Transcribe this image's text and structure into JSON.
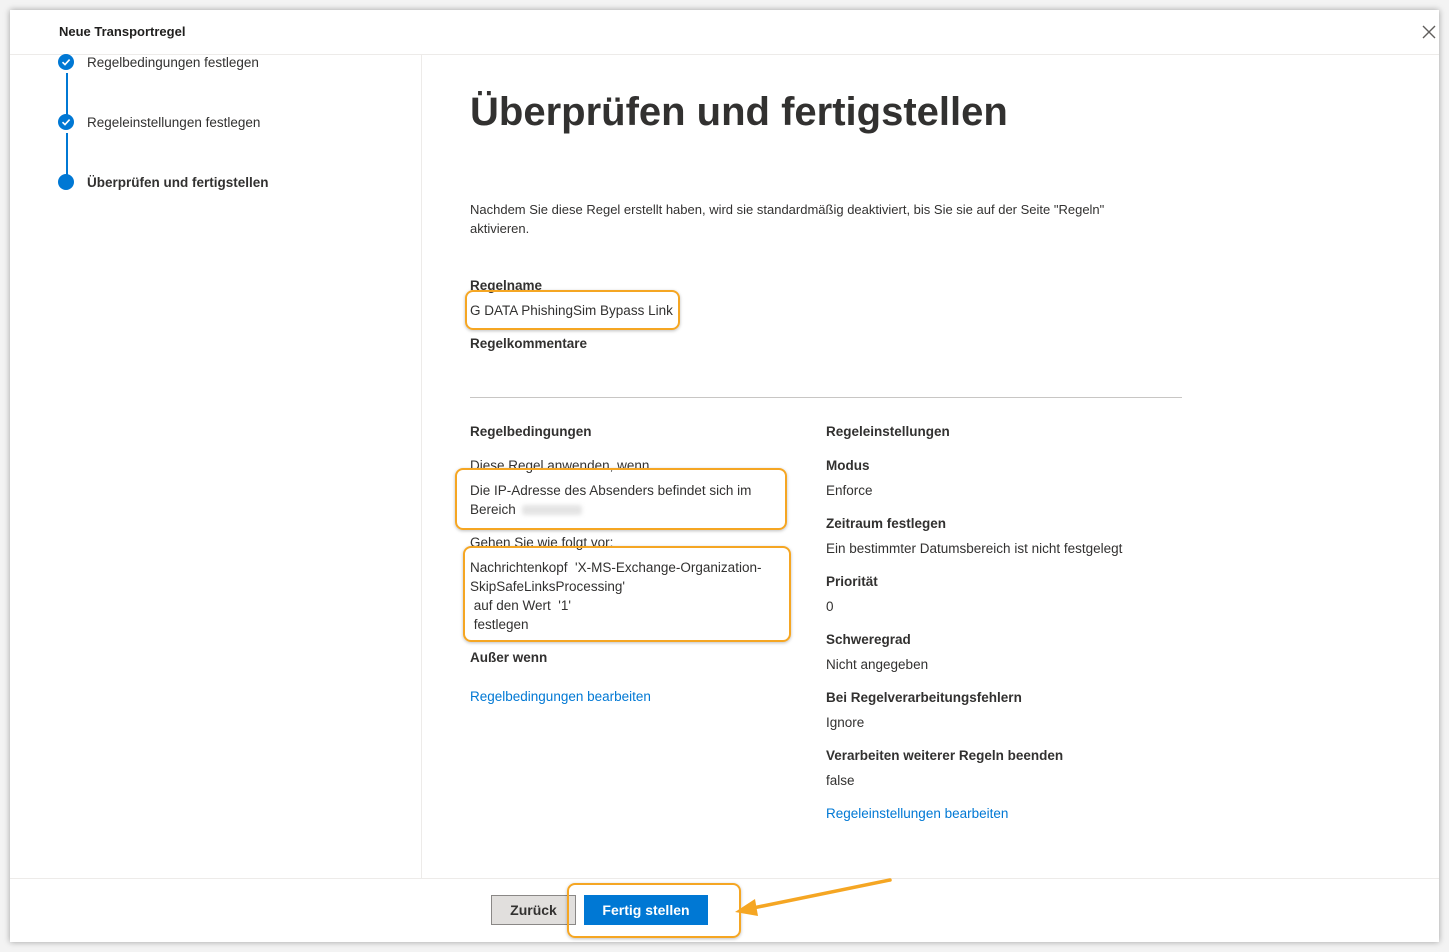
{
  "wizard": {
    "title": "Neue Transportregel"
  },
  "steps": [
    {
      "label": "Regelbedingungen festlegen",
      "state": "done"
    },
    {
      "label": "Regeleinstellungen festlegen",
      "state": "done"
    },
    {
      "label": "Überprüfen und fertigstellen",
      "state": "current"
    }
  ],
  "main": {
    "heading": "Überprüfen und fertigstellen",
    "intro": "Nachdem Sie diese Regel erstellt haben, wird sie standardmäßig deaktiviert, bis Sie sie auf der Seite \"Regeln\" aktivieren.",
    "rule_name_label": "Regelname",
    "rule_name_value": "G DATA PhishingSim Bypass Link",
    "rule_comments_label": "Regelkommentare"
  },
  "conditions": {
    "section_title": "Regelbedingungen",
    "apply_label": "Diese Regel anwenden, wenn",
    "apply_value": "Die IP-Adresse des Absenders befindet sich im Bereich",
    "do_label": "Gehen Sie wie folgt vor:",
    "do_line1": "Nachrichtenkopf  'X-MS-Exchange-Organization-",
    "do_line2": "SkipSafeLinksProcessing'",
    "do_line3": " auf den Wert  '1'",
    "do_line4": " festlegen",
    "except_label": "Außer wenn",
    "edit_link": "Regelbedingungen bearbeiten"
  },
  "settings": {
    "section_title": "Regeleinstellungen",
    "mode_label": "Modus",
    "mode_value": "Enforce",
    "period_label": "Zeitraum festlegen",
    "period_value": "Ein bestimmter Datumsbereich ist nicht festgelegt",
    "priority_label": "Priorität",
    "priority_value": "0",
    "severity_label": "Schweregrad",
    "severity_value": "Nicht angegeben",
    "errors_label": "Bei Regelverarbeitungsfehlern",
    "errors_value": "Ignore",
    "stop_label": "Verarbeiten weiterer Regeln beenden",
    "stop_value": "false",
    "edit_link": "Regeleinstellungen bearbeiten"
  },
  "footer": {
    "back_label": "Zurück",
    "finish_label": "Fertig stellen"
  },
  "colors": {
    "accent": "#0078d4",
    "highlight": "#f5a623"
  },
  "icons": {
    "close": "close-icon",
    "step_done": "checkmark-icon",
    "step_current": "filled-circle-icon",
    "annotation": "arrow-icon"
  }
}
